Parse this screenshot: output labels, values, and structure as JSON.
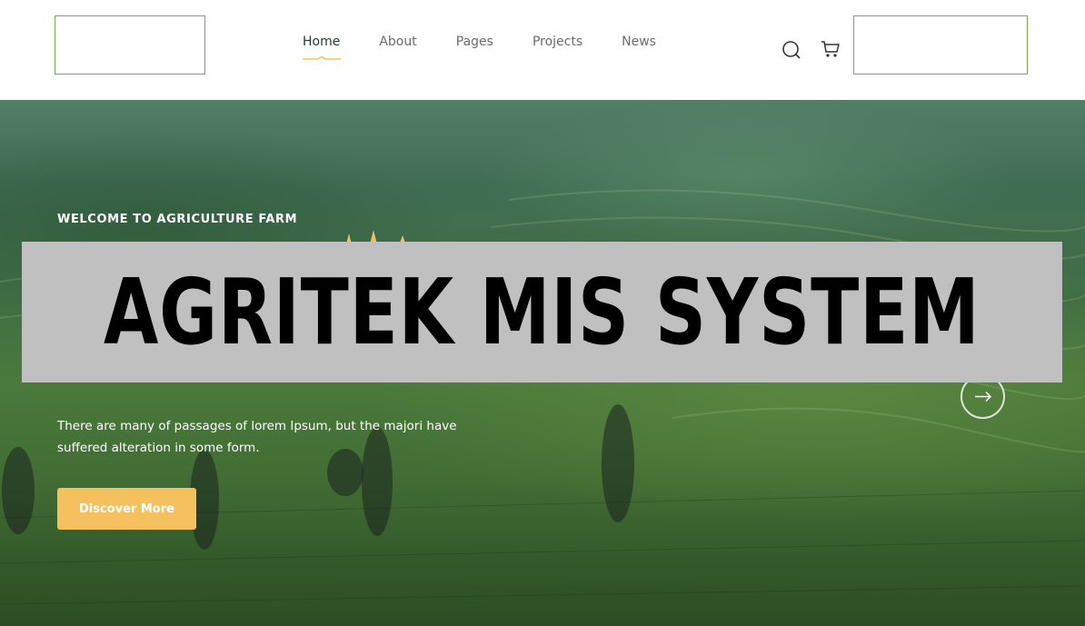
{
  "nav": {
    "items": [
      {
        "label": "Home",
        "active": true
      },
      {
        "label": "About",
        "active": false
      },
      {
        "label": "Pages",
        "active": false
      },
      {
        "label": "Projects",
        "active": false
      },
      {
        "label": "News",
        "active": false
      }
    ],
    "icons": [
      "search-icon",
      "cart-icon"
    ]
  },
  "hero": {
    "tagline": "WELCOME TO AGRICULTURE FARM",
    "description": "There are many of passages of lorem Ipsum, but the majori have suffered alteration in some form.",
    "button_label": "Discover More",
    "next_icon": "arrow-right-icon"
  },
  "banner": {
    "text": "AGRITEK MIS SYSTEM"
  },
  "colors": {
    "accent": "#f5c15e",
    "nav_active": "#1f3d2b",
    "nav_text": "#6b6b6b",
    "placeholder_border": "#6fb04a",
    "banner_bg": "#c0c0c0"
  }
}
